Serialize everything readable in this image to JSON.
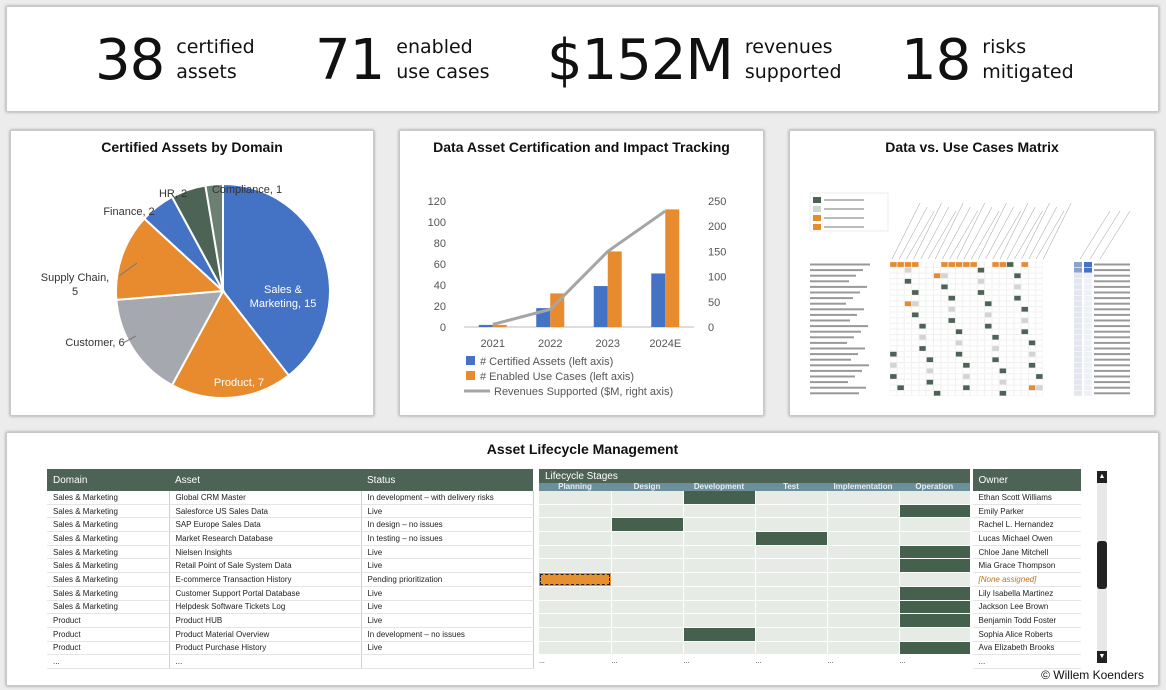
{
  "kpis": [
    {
      "value": "38",
      "label1": "certified",
      "label2": "assets"
    },
    {
      "value": "71",
      "label1": "enabled",
      "label2": "use cases"
    },
    {
      "value": "$152M",
      "label1": "revenues",
      "label2": "supported"
    },
    {
      "value": "18",
      "label1": "risks",
      "label2": "mitigated"
    }
  ],
  "pie": {
    "title": "Certified Assets by Domain",
    "chart_data": {
      "type": "pie",
      "labels": [
        "Sales & Marketing, 15",
        "Product, 7",
        "Customer, 6",
        "Supply Chain, 5",
        "Finance, 2",
        "HR, 2",
        "Compliance, 1"
      ],
      "values": [
        15,
        7,
        6,
        5,
        2,
        2,
        1
      ],
      "colors": [
        "#4472c4",
        "#e88b2e",
        "#a5a8ae",
        "#e88b2e",
        "#4472c4",
        "#4d6355",
        "#6b7f72"
      ]
    }
  },
  "combo": {
    "title": "Data Asset Certification and Impact Tracking",
    "chart_data": {
      "type": "bar",
      "categories": [
        "2021",
        "2022",
        "2023",
        "2024E"
      ],
      "series": [
        {
          "name": "# Certified Assets (left axis)",
          "values": [
            2,
            18,
            39,
            51
          ],
          "color": "#4472c4"
        },
        {
          "name": "# Enabled Use Cases (left axis)",
          "values": [
            2,
            32,
            72,
            112
          ],
          "color": "#e88b2e"
        },
        {
          "name": "Revenues Supported ($M, right axis)",
          "values": [
            5,
            35,
            150,
            230
          ],
          "color": "#a5a5a5",
          "kind": "line"
        }
      ],
      "yticks_left": [
        "0",
        "20",
        "40",
        "60",
        "80",
        "100",
        "120"
      ],
      "yticks_right": [
        "0",
        "50",
        "100",
        "150",
        "200",
        "250"
      ],
      "ylim_left": [
        0,
        120
      ],
      "ylim_right": [
        0,
        250
      ]
    }
  },
  "matrix": {
    "title": "Data vs. Use Cases Matrix"
  },
  "lifecycle": {
    "title": "Asset Lifecycle Management",
    "headers": {
      "domain": "Domain",
      "asset": "Asset",
      "status": "Status",
      "stages": "Lifecycle Stages",
      "owner": "Owner"
    },
    "stages": [
      "Planning",
      "Design",
      "Development",
      "Test",
      "Implementation",
      "Operation"
    ],
    "rows": [
      {
        "domain": "Sales & Marketing",
        "asset": "Global CRM Master",
        "status": "In development – with delivery risks",
        "owner": "Ethan Scott Williams",
        "stage": 2,
        "kind": "dark"
      },
      {
        "domain": "Sales & Marketing",
        "asset": "Salesforce US Sales Data",
        "status": "Live",
        "owner": "Emily Parker",
        "stage": 5,
        "kind": "dark"
      },
      {
        "domain": "Sales & Marketing",
        "asset": "SAP Europe Sales Data",
        "status": "In design – no issues",
        "owner": "Rachel L. Hernandez",
        "stage": 1,
        "kind": "dark"
      },
      {
        "domain": "Sales & Marketing",
        "asset": "Market Research Database",
        "status": "In testing – no issues",
        "owner": "Lucas Michael Owen",
        "stage": 3,
        "kind": "dark"
      },
      {
        "domain": "Sales & Marketing",
        "asset": "Nielsen Insights",
        "status": "Live",
        "owner": "Chloe Jane Mitchell",
        "stage": 5,
        "kind": "dark"
      },
      {
        "domain": "Sales & Marketing",
        "asset": "Retail Point of Sale System Data",
        "status": "Live",
        "owner": "Mia Grace Thompson",
        "stage": 5,
        "kind": "dark"
      },
      {
        "domain": "Sales & Marketing",
        "asset": "E-commerce Transaction History",
        "status": "Pending prioritization",
        "owner": "[None assigned]",
        "stage": 0,
        "kind": "orange"
      },
      {
        "domain": "Sales & Marketing",
        "asset": "Customer Support Portal Database",
        "status": "Live",
        "owner": "Lily Isabella Martinez",
        "stage": 5,
        "kind": "dark"
      },
      {
        "domain": "Sales & Marketing",
        "asset": "Helpdesk Software Tickets Log",
        "status": "Live",
        "owner": "Jackson Lee Brown",
        "stage": 5,
        "kind": "dark"
      },
      {
        "domain": "Product",
        "asset": "Product HUB",
        "status": "Live",
        "owner": "Benjamin Todd Foster",
        "stage": 5,
        "kind": "dark"
      },
      {
        "domain": "Product",
        "asset": "Product Material Overview",
        "status": "In development – no issues",
        "owner": "Sophia Alice Roberts",
        "stage": 2,
        "kind": "dark"
      },
      {
        "domain": "Product",
        "asset": "Product Purchase History",
        "status": "Live",
        "owner": "Ava Elizabeth Brooks",
        "stage": 5,
        "kind": "dark"
      },
      {
        "domain": "...",
        "asset": "...",
        "status": "",
        "owner": "...",
        "stage": -1,
        "kind": "none"
      }
    ]
  },
  "copyright": "© Willem Koenders"
}
